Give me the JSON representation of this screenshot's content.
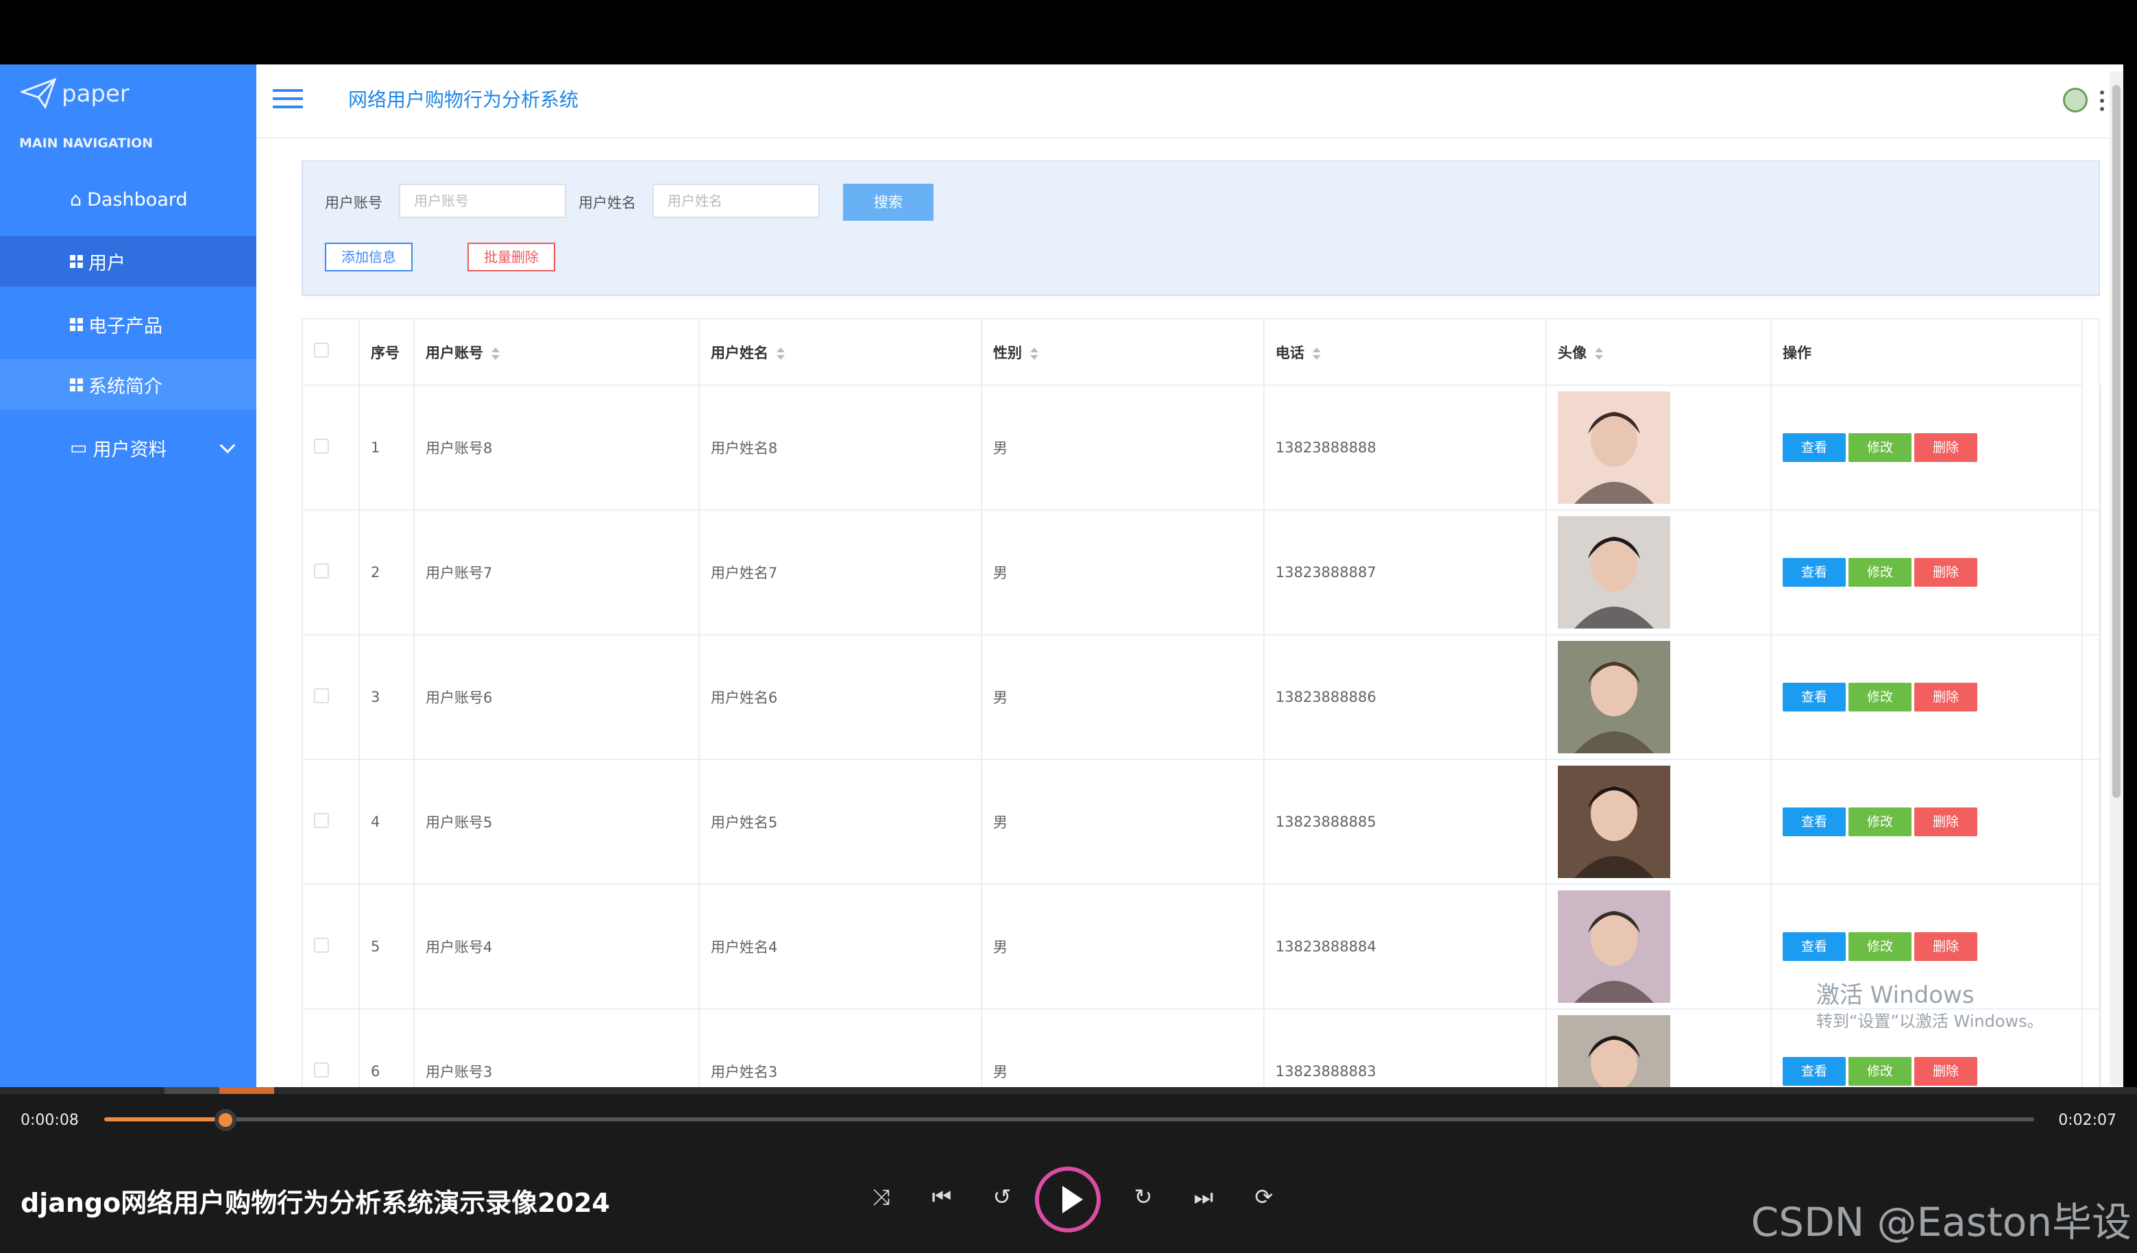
{
  "app": {
    "logo_text": "paper",
    "title": "网络用户购物行为分析系统"
  },
  "sidebar": {
    "section_label": "MAIN NAVIGATION",
    "items": [
      {
        "label": "Dashboard",
        "icon": "home-icon"
      },
      {
        "label": "用户",
        "icon": "grid-icon",
        "active": true
      },
      {
        "label": "电子产品",
        "icon": "grid-icon"
      },
      {
        "label": "系统简介",
        "icon": "grid-icon"
      },
      {
        "label": "用户资料",
        "icon": "folder-icon"
      }
    ]
  },
  "search": {
    "account_label": "用户账号",
    "account_placeholder": "用户账号",
    "name_label": "用户姓名",
    "name_placeholder": "用户姓名",
    "search_button": "搜索",
    "add_button": "添加信息",
    "batch_delete_button": "批量删除"
  },
  "table": {
    "columns": [
      "序号",
      "用户账号",
      "用户姓名",
      "性别",
      "电话",
      "头像",
      "操作"
    ],
    "rows": [
      {
        "index": "1",
        "account": "用户账号8",
        "name": "用户姓名8",
        "gender": "男",
        "phone": "13823888888"
      },
      {
        "index": "2",
        "account": "用户账号7",
        "name": "用户姓名7",
        "gender": "男",
        "phone": "13823888887"
      },
      {
        "index": "3",
        "account": "用户账号6",
        "name": "用户姓名6",
        "gender": "男",
        "phone": "13823888886"
      },
      {
        "index": "4",
        "account": "用户账号5",
        "name": "用户姓名5",
        "gender": "男",
        "phone": "13823888885"
      },
      {
        "index": "5",
        "account": "用户账号4",
        "name": "用户姓名4",
        "gender": "男",
        "phone": "13823888884"
      },
      {
        "index": "6",
        "account": "用户账号3",
        "name": "用户姓名3",
        "gender": "男",
        "phone": "13823888883"
      }
    ],
    "actions": {
      "view": "查看",
      "edit": "修改",
      "delete": "删除"
    }
  },
  "watermark": {
    "line1": "激活 Windows",
    "line2": "转到“设置”以激活 Windows。"
  },
  "player": {
    "current_time": "0:00:08",
    "total_time": "0:02:07",
    "progress": 0.063,
    "video_title": "django网络用户购物行为分析系统演示录像2024",
    "overlay": "CSDN @Easton毕设"
  },
  "colors": {
    "sidebar": "#3a88fd",
    "accent": "#1f86e8",
    "view": "#1c9cf0",
    "edit": "#6cbd45",
    "delete": "#f25f5f"
  }
}
